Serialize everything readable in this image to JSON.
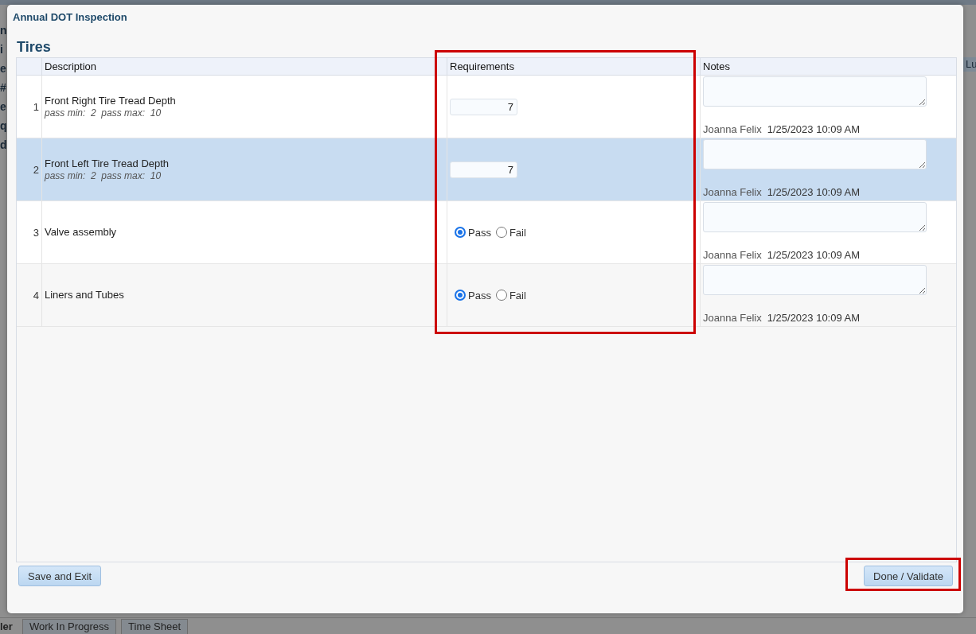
{
  "background": {
    "left_fragments": [
      "n",
      "i",
      "e",
      "#",
      "e",
      "q",
      "d"
    ],
    "right_fragment": "Lu",
    "bottom_tabs": [
      {
        "label": "ler",
        "selected": true
      },
      {
        "label": "Work In Progress",
        "selected": false
      },
      {
        "label": "Time Sheet",
        "selected": false
      }
    ]
  },
  "dialog": {
    "title": "Annual DOT Inspection",
    "section": "Tires",
    "table": {
      "columns": [
        {
          "label": "Description",
          "highlighted": false
        },
        {
          "label": "Requirements",
          "highlighted": true
        },
        {
          "label": "Notes",
          "highlighted": false
        }
      ],
      "rows": [
        {
          "index": "1",
          "description": "Front Right Tire Tread Depth",
          "limits": "pass min:  2  pass max:  10",
          "selected": false,
          "kind": "number",
          "value": "7",
          "author": "Joanna Felix",
          "timestamp": "1/25/2023 10:09 AM"
        },
        {
          "index": "2",
          "description": "Front Left Tire Tread Depth",
          "limits": "pass min:  2  pass max:  10",
          "selected": true,
          "kind": "number",
          "value": "7",
          "author": "Joanna Felix",
          "timestamp": "1/25/2023 10:09 AM"
        },
        {
          "index": "3",
          "description": "Valve assembly",
          "selected": false,
          "kind": "passfail",
          "options": [
            {
              "label": "Pass",
              "selected": true
            },
            {
              "label": "Fail",
              "selected": false
            }
          ],
          "author": "Joanna Felix",
          "timestamp": "1/25/2023 10:09 AM"
        },
        {
          "index": "4",
          "description": "Liners and Tubes",
          "selected": false,
          "kind": "passfail",
          "options": [
            {
              "label": "Pass",
              "selected": true
            },
            {
              "label": "Fail",
              "selected": false
            }
          ],
          "author": "Joanna Felix",
          "timestamp": "1/25/2023 10:09 AM"
        }
      ]
    },
    "buttons": [
      {
        "label": "Save and Exit",
        "highlighted": false
      },
      {
        "label": "Done / Validate",
        "highlighted": true
      }
    ]
  }
}
